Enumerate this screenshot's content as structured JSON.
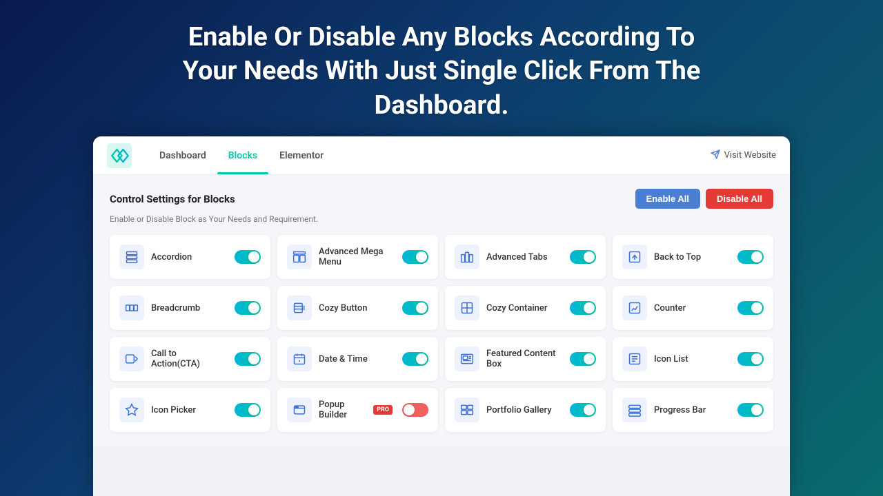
{
  "hero": {
    "title": "Enable Or Disable Any Blocks According To Your Needs With Just Single Click From The Dashboard."
  },
  "nav": {
    "logo_alt": "Cozy Blocks Logo",
    "tabs": [
      {
        "id": "dashboard",
        "label": "Dashboard",
        "active": false
      },
      {
        "id": "blocks",
        "label": "Blocks",
        "active": true
      },
      {
        "id": "elementor",
        "label": "Elementor",
        "active": false
      }
    ],
    "visit_website": "Visit Website"
  },
  "section": {
    "title": "Control Settings for Blocks",
    "description": "Enable or Disable Block as Your Needs and Requirement.",
    "enable_all_label": "Enable All",
    "disable_all_label": "Disable All"
  },
  "blocks": [
    {
      "id": "accordion",
      "name": "Accordion",
      "state": "on",
      "pro": false
    },
    {
      "id": "advanced-mega-menu",
      "name": "Advanced Mega Menu",
      "state": "on",
      "pro": false
    },
    {
      "id": "advanced-tabs",
      "name": "Advanced Tabs",
      "state": "on",
      "pro": false
    },
    {
      "id": "back-to-top",
      "name": "Back to Top",
      "state": "on",
      "pro": false
    },
    {
      "id": "breadcrumb",
      "name": "Breadcrumb",
      "state": "on",
      "pro": false
    },
    {
      "id": "cozy-button",
      "name": "Cozy Button",
      "state": "on",
      "pro": false
    },
    {
      "id": "cozy-container",
      "name": "Cozy Container",
      "state": "on",
      "pro": false
    },
    {
      "id": "counter",
      "name": "Counter",
      "state": "on",
      "pro": false
    },
    {
      "id": "call-to-action",
      "name": "Call to Action(CTA)",
      "state": "on",
      "pro": false
    },
    {
      "id": "date-time",
      "name": "Date & Time",
      "state": "on",
      "pro": false
    },
    {
      "id": "featured-content-box",
      "name": "Featured Content Box",
      "state": "on",
      "pro": false
    },
    {
      "id": "icon-list",
      "name": "Icon List",
      "state": "on",
      "pro": false
    },
    {
      "id": "icon-picker",
      "name": "Icon Picker",
      "state": "on",
      "pro": false
    },
    {
      "id": "popup-builder",
      "name": "Popup Builder",
      "state": "red-off",
      "pro": true
    },
    {
      "id": "portfolio-gallery",
      "name": "Portfolio Gallery",
      "state": "on",
      "pro": false
    },
    {
      "id": "progress-bar",
      "name": "Progress Bar",
      "state": "on",
      "pro": false
    }
  ]
}
